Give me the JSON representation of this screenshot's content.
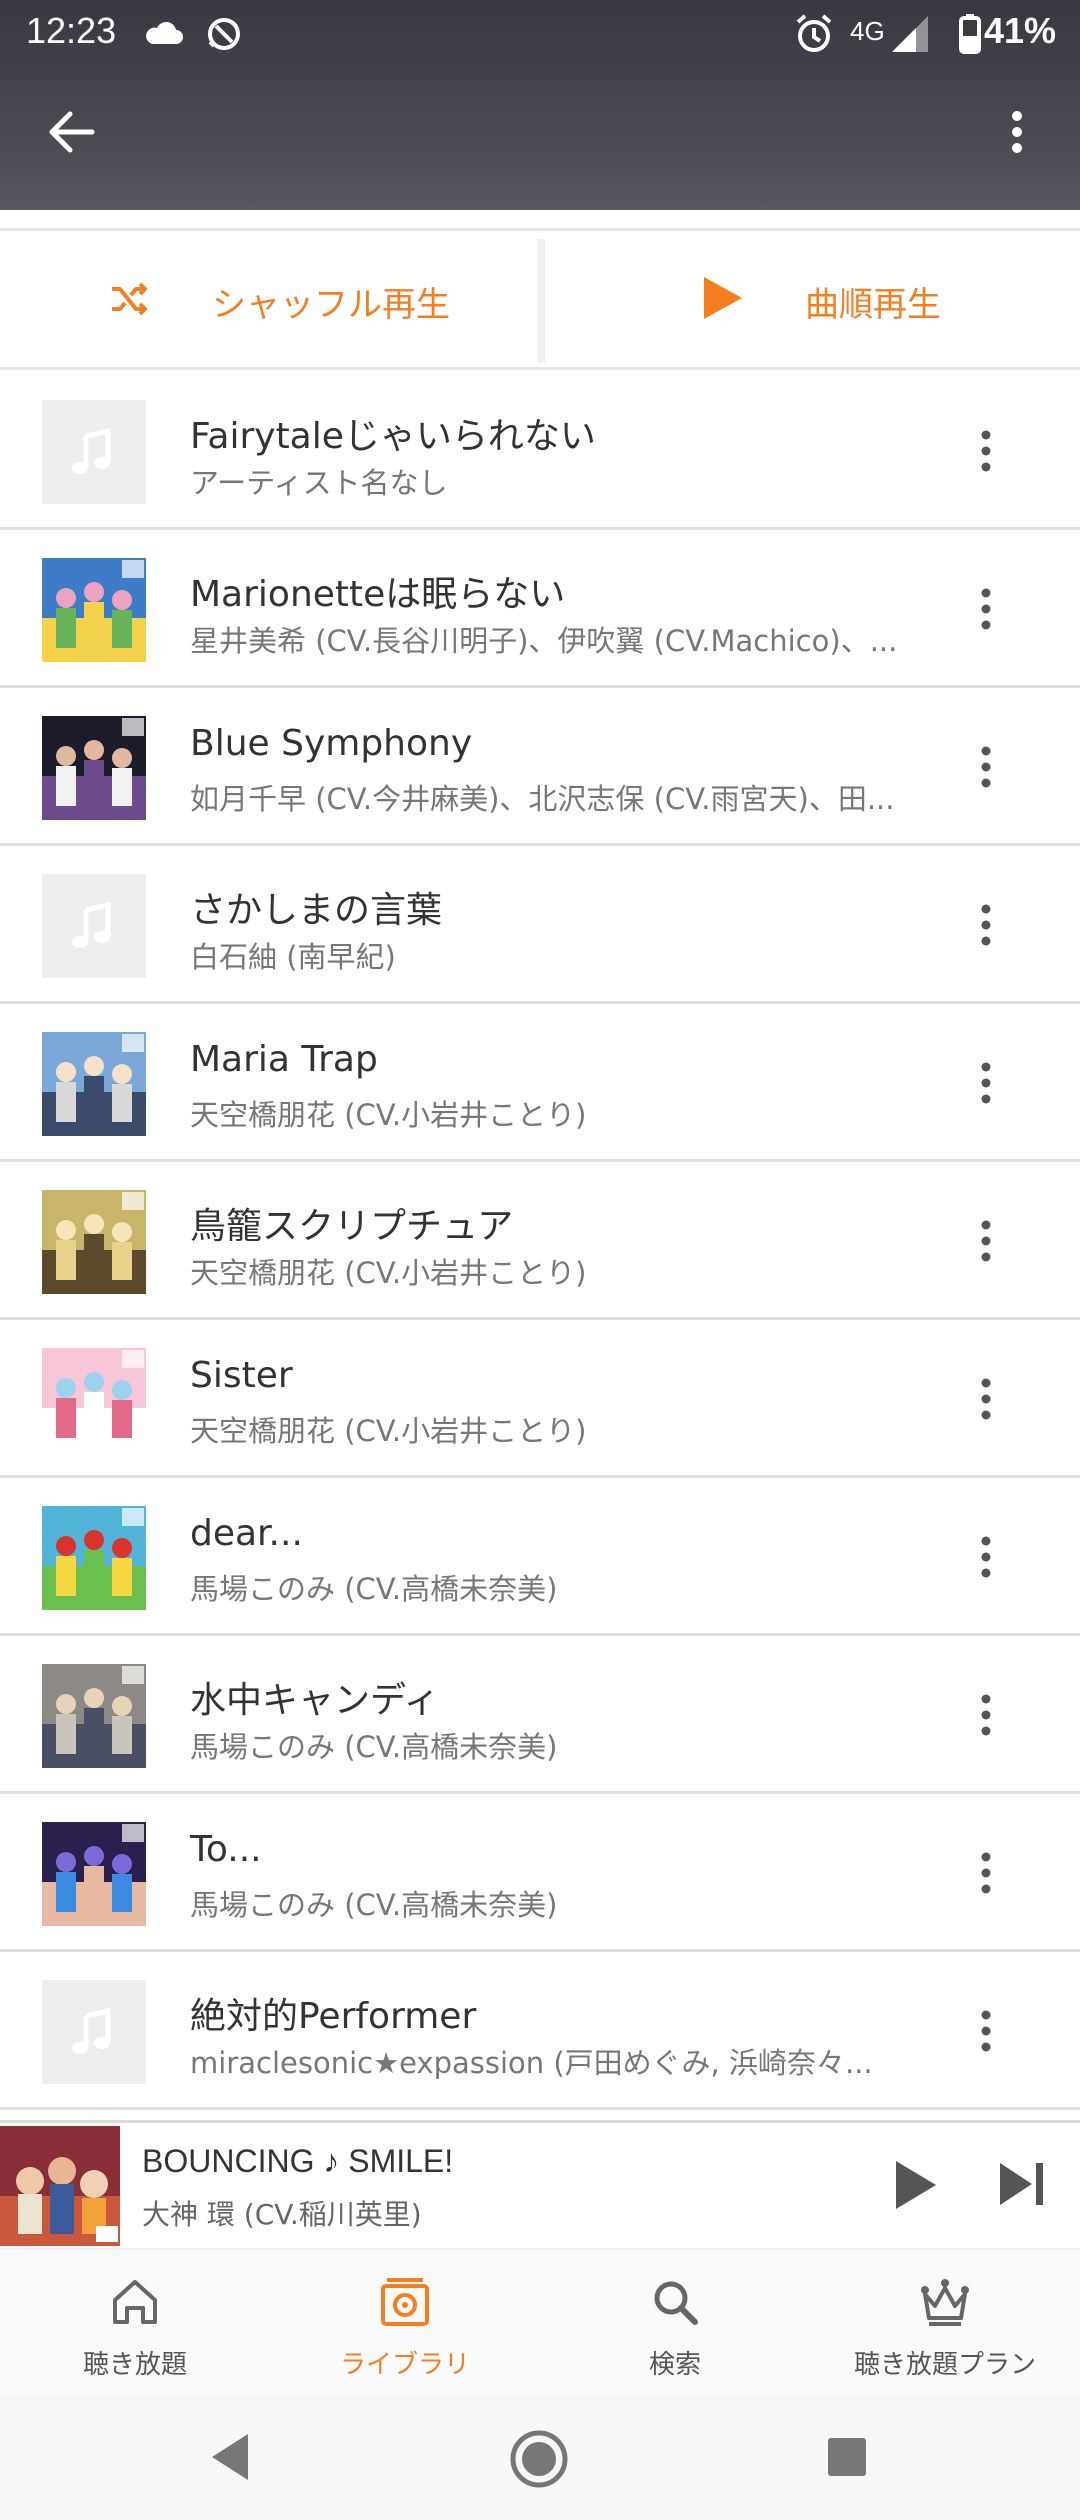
{
  "status_bar": {
    "time": "12:23",
    "network": "4G",
    "battery": "41%",
    "icons": [
      "cloud-icon",
      "sync-icon",
      "alarm-icon",
      "signal-icon",
      "battery-icon"
    ]
  },
  "header": {
    "back_icon": "arrow-left-icon",
    "menu_icon": "more-vert-icon"
  },
  "play_bar": {
    "shuffle_label": "シャッフル再生",
    "order_label": "曲順再生"
  },
  "tracks": [
    {
      "title": "Fairytaleじゃいられない",
      "artist": "アーティスト名なし",
      "art": "placeholder"
    },
    {
      "title": "Marionetteは眠らない",
      "artist": "星井美希 (CV.長谷川明子)、伊吹翼 (CV.Machico)、...",
      "art": "cover"
    },
    {
      "title": "Blue Symphony",
      "artist": "如月千早 (CV.今井麻美)、北沢志保 (CV.雨宮天)、田...",
      "art": "cover"
    },
    {
      "title": "さかしまの言葉",
      "artist": "白石紬 (南早紀)",
      "art": "placeholder"
    },
    {
      "title": "Maria Trap",
      "artist": "天空橋朋花 (CV.小岩井ことり)",
      "art": "cover"
    },
    {
      "title": "鳥籠スクリプチュア",
      "artist": "天空橋朋花 (CV.小岩井ことり)",
      "art": "cover"
    },
    {
      "title": "Sister",
      "artist": "天空橋朋花 (CV.小岩井ことり)",
      "art": "cover"
    },
    {
      "title": "dear...",
      "artist": "馬場このみ (CV.高橋未奈美)",
      "art": "cover"
    },
    {
      "title": "水中キャンディ",
      "artist": "馬場このみ (CV.高橋未奈美)",
      "art": "cover"
    },
    {
      "title": "To...",
      "artist": "馬場このみ (CV.高橋未奈美)",
      "art": "cover"
    },
    {
      "title": "絶対的Performer",
      "artist": "miraclesonic★expassion (戸田めぐみ, 浜崎奈々...",
      "art": "placeholder"
    }
  ],
  "mini_player": {
    "title": "BOUNCING ♪ SMILE!",
    "artist": "大神 環 (CV.稲川英里)"
  },
  "bottom_nav": [
    {
      "label": "聴き放題",
      "icon": "home-icon",
      "active": false
    },
    {
      "label": "ライブラリ",
      "icon": "library-icon",
      "active": true
    },
    {
      "label": "検索",
      "icon": "search-icon",
      "active": false
    },
    {
      "label": "聴き放題プラン",
      "icon": "crown-icon",
      "active": false
    }
  ],
  "colors": {
    "accent": "#f57e20",
    "header_bg": "#45414a",
    "divider": "#dedede"
  }
}
